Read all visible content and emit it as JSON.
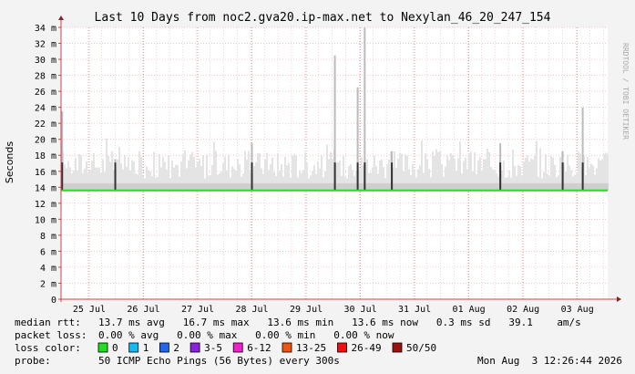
{
  "chart_data": {
    "type": "area",
    "title": "Last 10 Days from noc2.gva20.ip-max.net to Nexylan_46_20_247_154",
    "ylabel": "Seconds",
    "watermark": "RRDTOOL / TOBI OETIKER",
    "ylim": [
      0,
      34
    ],
    "yticks": [
      {
        "v": 0,
        "label": "0"
      },
      {
        "v": 2,
        "label": "2 m"
      },
      {
        "v": 4,
        "label": "4 m"
      },
      {
        "v": 6,
        "label": "6 m"
      },
      {
        "v": 8,
        "label": "8 m"
      },
      {
        "v": 10,
        "label": "10 m"
      },
      {
        "v": 12,
        "label": "12 m"
      },
      {
        "v": 14,
        "label": "14 m"
      },
      {
        "v": 16,
        "label": "16 m"
      },
      {
        "v": 18,
        "label": "18 m"
      },
      {
        "v": 20,
        "label": "20 m"
      },
      {
        "v": 22,
        "label": "22 m"
      },
      {
        "v": 24,
        "label": "24 m"
      },
      {
        "v": 26,
        "label": "26 m"
      },
      {
        "v": 28,
        "label": "28 m"
      },
      {
        "v": 30,
        "label": "30 m"
      },
      {
        "v": 32,
        "label": "32 m"
      },
      {
        "v": 34,
        "label": "34 m"
      }
    ],
    "xlim": [
      0,
      10.08
    ],
    "xticks": [
      {
        "day": 0.52,
        "label": "25 Jul"
      },
      {
        "day": 1.52,
        "label": "26 Jul"
      },
      {
        "day": 2.52,
        "label": "27 Jul"
      },
      {
        "day": 3.52,
        "label": "28 Jul"
      },
      {
        "day": 4.52,
        "label": "29 Jul"
      },
      {
        "day": 5.52,
        "label": "30 Jul"
      },
      {
        "day": 6.52,
        "label": "31 Jul"
      },
      {
        "day": 7.52,
        "label": "01 Aug"
      },
      {
        "day": 8.52,
        "label": "02 Aug"
      },
      {
        "day": 9.52,
        "label": "03 Aug"
      }
    ],
    "series": [
      {
        "name": "median rtt",
        "color": "#22dd22",
        "x": [
          0.0,
          0.95,
          1.0,
          1.5,
          2.0,
          3.0,
          3.8,
          4.0,
          5.0,
          5.2,
          5.4,
          5.6,
          6.0,
          7.0,
          8.0,
          9.0,
          9.6,
          10.08
        ],
        "values": [
          13.6,
          13.6,
          13.6,
          13.6,
          13.6,
          13.6,
          13.6,
          13.6,
          13.6,
          13.6,
          13.6,
          13.6,
          13.6,
          13.6,
          13.6,
          13.6,
          13.6,
          13.6
        ]
      }
    ],
    "smoke_peaks": [
      {
        "day": 0.02,
        "top": 23.5
      },
      {
        "day": 1.0,
        "top": 17.5
      },
      {
        "day": 3.52,
        "top": 19.5
      },
      {
        "day": 5.05,
        "top": 30.5
      },
      {
        "day": 5.47,
        "top": 26.5
      },
      {
        "day": 5.6,
        "top": 34.0
      },
      {
        "day": 6.1,
        "top": 18.5
      },
      {
        "day": 8.1,
        "top": 19.5
      },
      {
        "day": 9.25,
        "top": 18.5
      },
      {
        "day": 9.62,
        "top": 24.0
      }
    ]
  },
  "legend": {
    "rows": [
      {
        "label": "median rtt:",
        "text": "13.7 ms avg   16.7 ms max   13.6 ms min   13.6 ms now   0.3 ms sd   39.1    am/s"
      },
      {
        "label": "packet loss:",
        "text": "0.00 % avg   0.00 % max   0.00 % min   0.00 % now"
      }
    ],
    "loss_label": "loss color:",
    "loss_colors": [
      {
        "label": "0",
        "color": "#22dd22"
      },
      {
        "label": "1",
        "color": "#11bbee"
      },
      {
        "label": "2",
        "color": "#2266ee"
      },
      {
        "label": "3-5",
        "color": "#8822dd"
      },
      {
        "label": "6-12",
        "color": "#ee22cc"
      },
      {
        "label": "13-25",
        "color": "#ee5511"
      },
      {
        "label": "26-49",
        "color": "#ee1111"
      },
      {
        "label": "50/50",
        "color": "#991111"
      }
    ],
    "probe_label": "probe:",
    "probe_text": "50 ICMP Echo Pings (56 Bytes) every 300s",
    "timestamp": "Mon Aug  3 12:26:44 2026"
  }
}
